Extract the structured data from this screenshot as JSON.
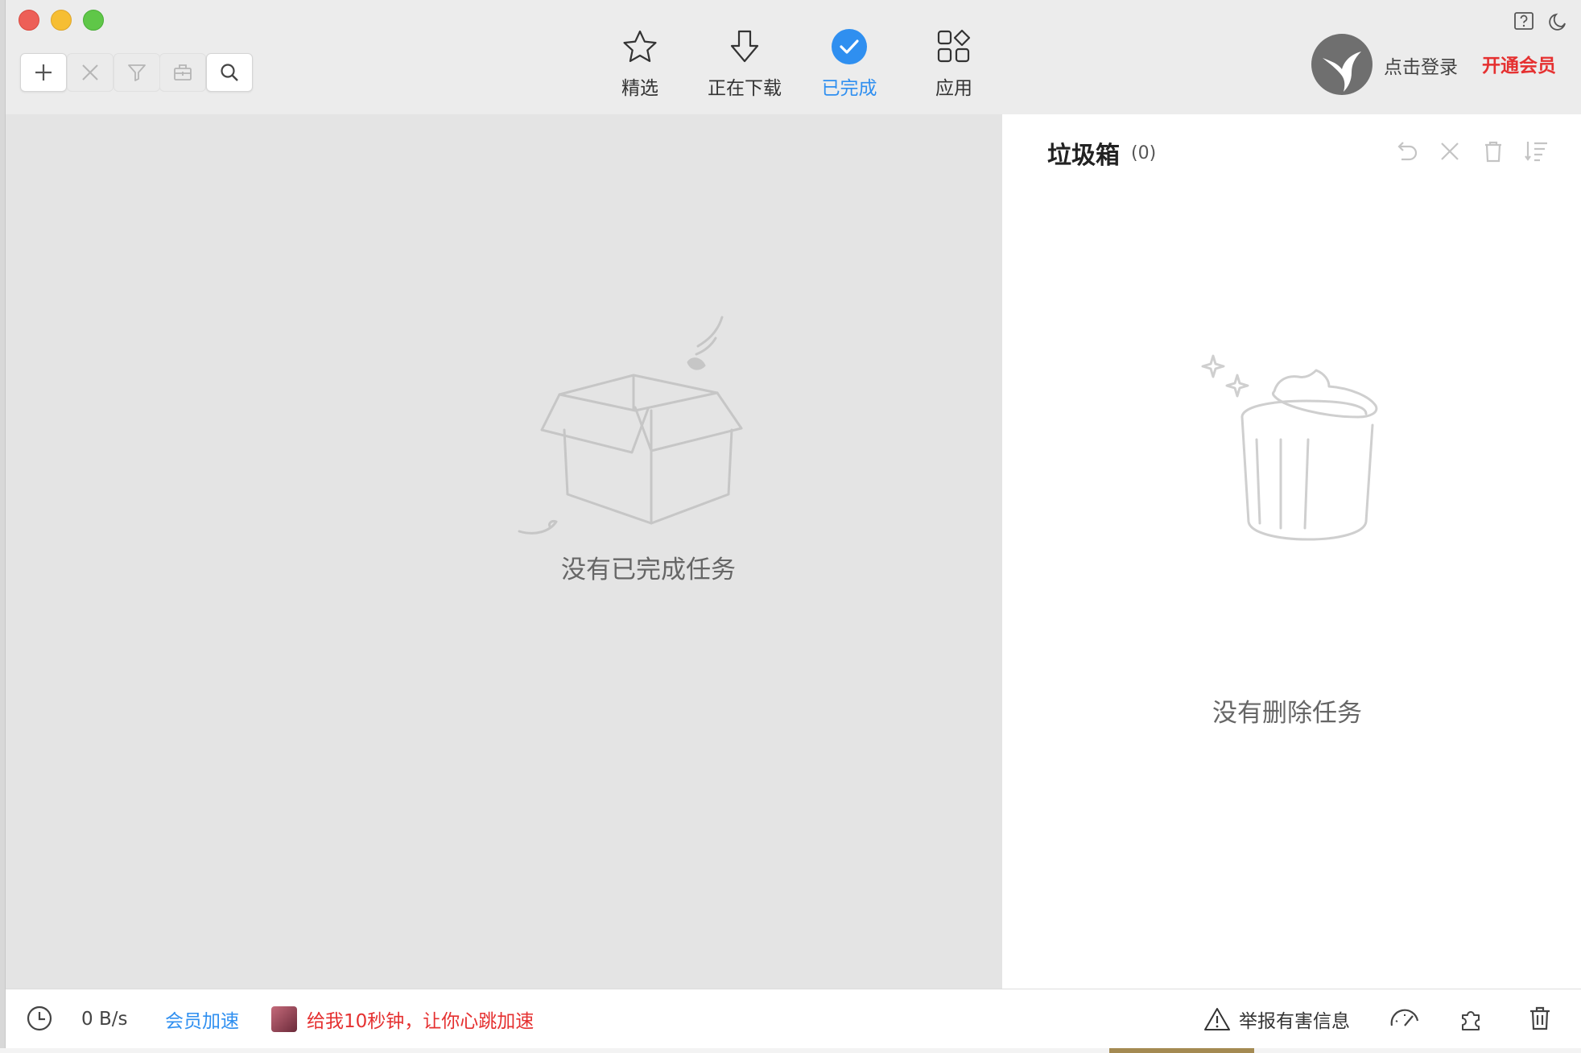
{
  "toolbar": {
    "buttons": [
      {
        "name": "new-task-button",
        "icon": "plus-icon"
      },
      {
        "name": "delete-button",
        "icon": "close-icon"
      },
      {
        "name": "filter-button",
        "icon": "filter-icon"
      },
      {
        "name": "toolbox-button",
        "icon": "briefcase-icon"
      },
      {
        "name": "search-button",
        "icon": "search-icon"
      }
    ]
  },
  "nav": {
    "tabs": [
      {
        "label": "精选",
        "icon": "star-icon"
      },
      {
        "label": "正在下载",
        "icon": "download-arrow-icon"
      },
      {
        "label": "已完成",
        "icon": "check-circle-icon",
        "active": true
      },
      {
        "label": "应用",
        "icon": "apps-grid-icon"
      }
    ],
    "active_color": "#2f8ff0"
  },
  "header_right": {
    "login_label": "点击登录",
    "vip_label": "开通会员",
    "vip_color": "#e53030"
  },
  "main": {
    "completed_empty_label": "没有已完成任务"
  },
  "trash": {
    "title": "垃圾箱",
    "count": "(0)",
    "empty_label": "没有删除任务",
    "actions": [
      "undo-icon",
      "close-icon",
      "trash-icon",
      "sort-icon"
    ]
  },
  "statusbar": {
    "speed": "0 B/s",
    "vip_speedup_label": "会员加速",
    "promo_text": "给我10秒钟，让你心跳加速",
    "report_label": "举报有害信息",
    "accent_blue": "#2f8ff0",
    "accent_red": "#e53030"
  }
}
